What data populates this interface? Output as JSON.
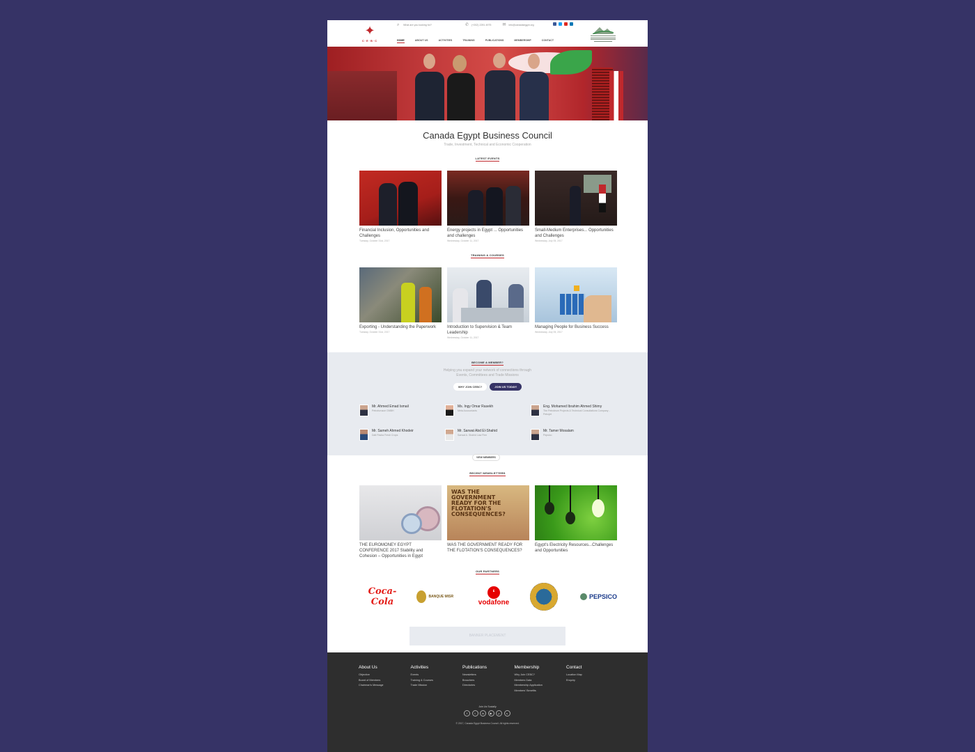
{
  "header": {
    "logo_text": "C·E·B·C",
    "search_placeholder": "What are you looking for?",
    "phone": "(+202) 2291 4975",
    "email": "info@canadaegypt.org",
    "nav": [
      "HOME",
      "ABOUT US",
      "ACTIVITIES",
      "TRAINING",
      "PUBLICATIONS",
      "MEMBERSHIP",
      "CONTACT"
    ],
    "active_nav": "HOME",
    "social_colors": [
      "#3b5998",
      "#1da1f2",
      "#e02a20",
      "#0077b5"
    ]
  },
  "hero": {
    "title": "Canada Egypt Business Council",
    "subtitle": "Trade, Investment, Technical and Economic Cooperation"
  },
  "events": {
    "label": "LATEST EVENTS",
    "items": [
      {
        "title": "Financial Inclusion, Opportunities and Challenges",
        "date": "Tuesday, October 31st, 2017"
      },
      {
        "title": "Energy projects in Egypt ... Opportunities and challenges",
        "date": "Wednesday, October 11, 2017"
      },
      {
        "title": "Small-Medium Enterprises... Opportunities and Challenges",
        "date": "Wednesday, July 05, 2017"
      }
    ]
  },
  "training": {
    "label": "TRAINING & COURSES",
    "items": [
      {
        "title": "Exporting - Understanding the Paperwork",
        "date": "Tuesday, October 31st, 2017"
      },
      {
        "title": "Introduction to Supervision & Team Leadership",
        "date": "Wednesday, October 11, 2017"
      },
      {
        "title": "Managing People for Business Success",
        "date": "Wednesday, July 05, 2017"
      }
    ]
  },
  "membership": {
    "label": "BECOME A MEMBER?",
    "desc_line1": "Helping you expand your network of connections through",
    "desc_line2": "Events, Committees and Trade Missions",
    "why_btn": "WHY JOIN CEBC?",
    "join_btn": "JOIN US TODAY!",
    "view_btn": "VIEW MEMBERS",
    "members": [
      {
        "name": "Mr. Ahmed Emad Ismail",
        "company": "Petrofurnace GMBH"
      },
      {
        "name": "Ms. Ingy Omar Rasekh",
        "company": "Meta Accountants"
      },
      {
        "name": "Eng. Mohamed Ibrahim Ahmed Shimy",
        "company": "The Petroleum Projects & Technical Consultations Company - Petrojet"
      },
      {
        "name": "Mr. Sameh Ahmed Khodeir",
        "company": "Dalt Pasha Fresh Crops"
      },
      {
        "name": "Mr. Sarwat Abd El-Shahid",
        "company": "Sarwat A. Shahid Law Firm"
      },
      {
        "name": "Mr. Tamer Mosalam",
        "company": "Pepsico"
      }
    ]
  },
  "newsletters": {
    "label": "RECENT NEWSLETTERS",
    "items": [
      {
        "title": "THE EUROMONEY EGYPT CONFERENCE 2017 Stability and Cohesion – Opportunities in Egypt"
      },
      {
        "title": "WAS THE GOVERNMENT READY FOR THE FLOTATION'S CONSEQUENCES?"
      },
      {
        "title": "Egypt's Electricity Resources...Challenges and Opportunities"
      }
    ],
    "poster_text": "WAS THE GOVERNMENT READY FOR THE FLOTATION'S CONSEQUENCES?"
  },
  "partners": {
    "label": "OUR PARTNERS",
    "items": [
      "Coca-Cola",
      "BANQUE MISR",
      "vodafone",
      "",
      "PEPSICO"
    ]
  },
  "banner": "BANNER PLACEMENT",
  "footer": {
    "columns": [
      {
        "title": "About Us",
        "links": [
          "Objective",
          "Board of Members",
          "Chairman's Message"
        ]
      },
      {
        "title": "Activities",
        "links": [
          "Events",
          "Training & Courses",
          "Trade Mission"
        ]
      },
      {
        "title": "Publications",
        "links": [
          "Newsletters",
          "Brouchers",
          "Directories"
        ]
      },
      {
        "title": "Membership",
        "links": [
          "Why Join CEBC?",
          "Members Data",
          "Membership Application",
          "Members' Benefits"
        ]
      },
      {
        "title": "Contact",
        "links": [
          "Location Map",
          "Enquiry"
        ]
      }
    ],
    "follow": "Join Us Socially",
    "copyright": "© 2017, Canada Egypt Business Council. All rights reserved."
  }
}
